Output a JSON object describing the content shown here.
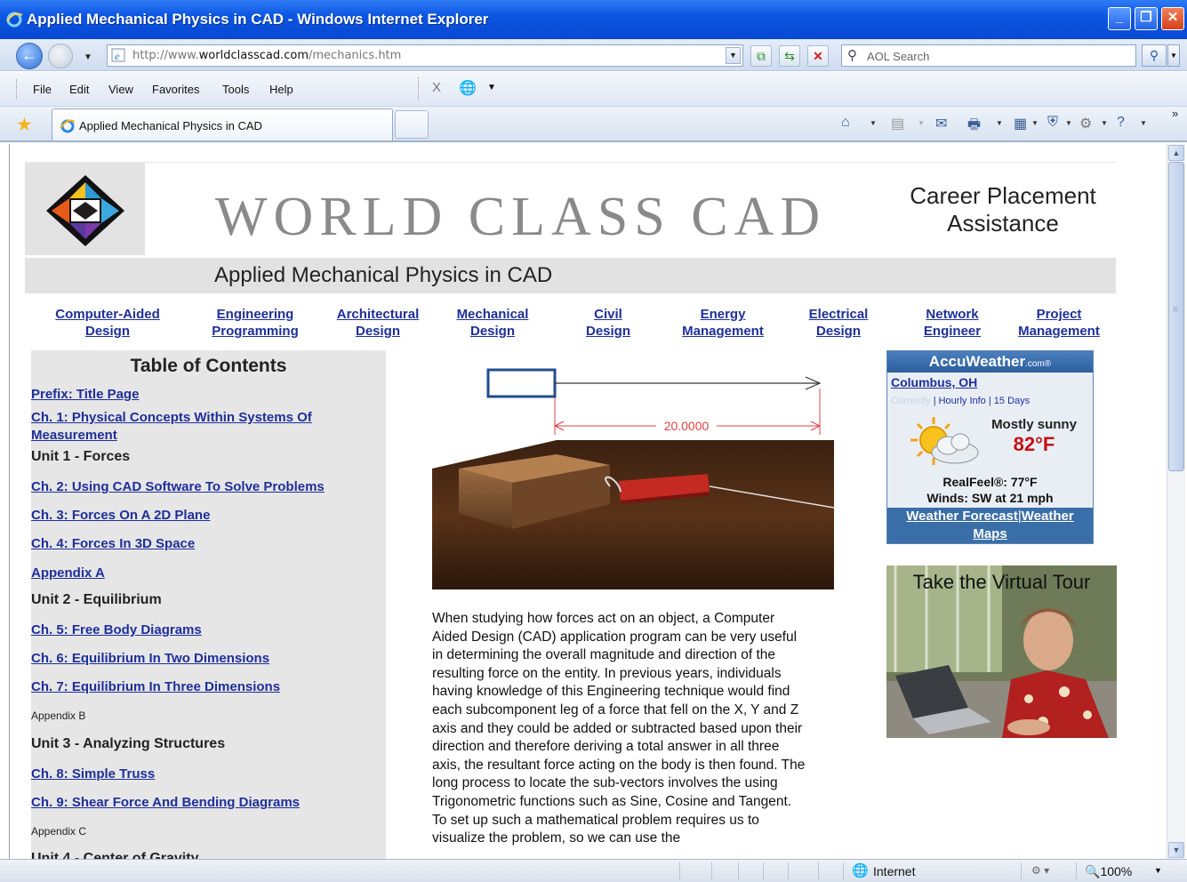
{
  "window": {
    "title": "Applied Mechanical Physics in CAD - Windows Internet Explorer",
    "minimize": "_",
    "restore": "❐",
    "close": "✕"
  },
  "address_bar": {
    "back": "←",
    "forward": "→",
    "url_prefix": "http://www.",
    "url_domain": "worldclasscad.com",
    "url_path": "/mechanics.htm",
    "search_placeholder": "AOL Search"
  },
  "menu": {
    "items": [
      "File",
      "Edit",
      "View",
      "Favorites",
      "Tools",
      "Help"
    ],
    "x_tool": "X"
  },
  "tab": {
    "label": "Applied Mechanical Physics in CAD"
  },
  "page": {
    "brand": "WORLD CLASS CAD",
    "career_line1": "Career Placement",
    "career_line2": "Assistance",
    "page_title": "Applied Mechanical Physics in CAD",
    "nav": [
      {
        "line1": "Computer-Aided",
        "line2": "Design"
      },
      {
        "line1": "Engineering",
        "line2": "Programming"
      },
      {
        "line1": "Architectural",
        "line2": "Design"
      },
      {
        "line1": "Mechanical",
        "line2": "Design"
      },
      {
        "line1": "Civil",
        "line2": "Design"
      },
      {
        "line1": "Energy",
        "line2": "Management"
      },
      {
        "line1": "Electrical",
        "line2": "Design"
      },
      {
        "line1": "Network",
        "line2": "Engineer"
      },
      {
        "line1": "Project",
        "line2": "Management"
      }
    ],
    "toc": {
      "title": "Table of Contents",
      "prefix": "Prefix: Title Page",
      "ch1_line1": "Ch. 1: Physical Concepts Within Systems Of",
      "ch1_line2": "Measurement",
      "unit1": "Unit 1 - Forces",
      "ch2": "Ch. 2: Using CAD Software To Solve Problems",
      "ch3": "Ch. 3: Forces On A 2D Plane",
      "ch4": "Ch. 4: Forces In 3D Space",
      "appendix_a": "Appendix A",
      "unit2": "Unit 2 - Equilibrium",
      "ch5": "Ch. 5: Free Body Diagrams",
      "ch6": "Ch. 6: Equilibrium In Two Dimensions",
      "ch7": "Ch. 7: Equilibrium In Three Dimensions",
      "appendix_b": "Appendix B",
      "unit3": "Unit 3 - Analyzing Structures",
      "ch8": "Ch. 8: Simple Truss",
      "ch9": "Ch. 9: Shear Force And Bending Diagrams",
      "appendix_c": "Appendix C",
      "unit4": "Unit 4 - Center of Gravity"
    },
    "hero_dimension": "20.0000",
    "article": "When studying how forces act on an object, a Computer Aided Design (CAD) application program can be very useful in determining the overall magnitude and direction of the resulting force on the entity. In previous years, individuals having knowledge of this Engineering technique would find each subcomponent leg of a force that fell on the X, Y and Z axis and they could be added or subtracted based upon their direction and therefore deriving a total answer in all three axis, the resultant force acting on the body is then found. The long process to locate the sub-vectors involves the using Trigonometric functions such as Sine, Cosine and Tangent. To set up such a mathematical problem requires us to visualize the problem, so we can use the",
    "weather": {
      "brand": "AccuWeather",
      "brand_suffix": ".com®",
      "city": "Columbus, OH",
      "currently": "Currently",
      "hourly": "Hourly Info",
      "sep": "|",
      "days": "15 Days",
      "condition": "Mostly sunny",
      "temp": "82°F",
      "realfeel": "RealFeel®: 77°F",
      "winds": "Winds: SW at 21 mph",
      "forecast_link": "Weather Forecast",
      "maps_link_1": "Weather",
      "maps_link_2": "Maps"
    },
    "tour_label": "Take the Virtual Tour"
  },
  "status": {
    "zone": "Internet",
    "zoom": "100%"
  },
  "colors": {
    "link": "#1e2f9a",
    "title_bar": "#0b56e2",
    "temp_red": "#c41212",
    "weather_blue": "#3a6ea8"
  }
}
